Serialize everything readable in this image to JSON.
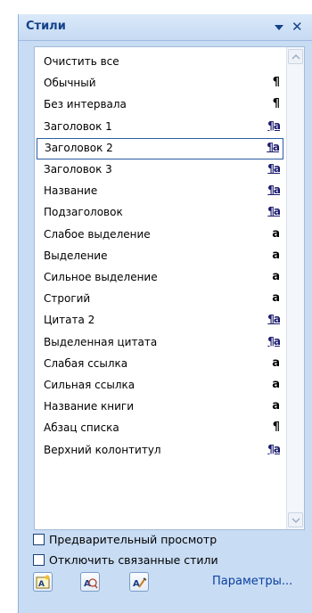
{
  "pane": {
    "title": "Стили",
    "menu_icon": "dropdown-arrow-icon",
    "close_icon": "close-icon"
  },
  "styles": [
    {
      "label": "Очистить все",
      "mark": "",
      "kind": "none"
    },
    {
      "label": "Обычный",
      "mark": "¶",
      "kind": "para"
    },
    {
      "label": "Без интервала",
      "mark": "¶",
      "kind": "para"
    },
    {
      "label": "Заголовок 1",
      "mark": "¶a",
      "kind": "link"
    },
    {
      "label": "Заголовок 2",
      "mark": "¶a",
      "kind": "link",
      "selected": true
    },
    {
      "label": "Заголовок 3",
      "mark": "¶a",
      "kind": "link"
    },
    {
      "label": "Название",
      "mark": "¶a",
      "kind": "link"
    },
    {
      "label": "Подзаголовок",
      "mark": "¶a",
      "kind": "link"
    },
    {
      "label": "Слабое выделение",
      "mark": "a",
      "kind": "char"
    },
    {
      "label": "Выделение",
      "mark": "a",
      "kind": "char"
    },
    {
      "label": "Сильное выделение",
      "mark": "a",
      "kind": "char"
    },
    {
      "label": "Строгий",
      "mark": "a",
      "kind": "char"
    },
    {
      "label": "Цитата 2",
      "mark": "¶a",
      "kind": "link"
    },
    {
      "label": "Выделенная цитата",
      "mark": "¶a",
      "kind": "link"
    },
    {
      "label": "Слабая ссылка",
      "mark": "a",
      "kind": "char"
    },
    {
      "label": "Сильная ссылка",
      "mark": "a",
      "kind": "char"
    },
    {
      "label": "Название книги",
      "mark": "a",
      "kind": "char"
    },
    {
      "label": "Абзац списка",
      "mark": "¶",
      "kind": "para"
    },
    {
      "label": "Верхний колонтитул",
      "mark": "¶a",
      "kind": "link"
    }
  ],
  "options": {
    "preview_label": "Предварительный просмотр",
    "preview_checked": false,
    "disable_linked_label": "Отключить связанные стили",
    "disable_linked_checked": false
  },
  "toolbar": {
    "new_style_icon": "new-style-icon",
    "style_inspector_icon": "style-inspector-icon",
    "manage_styles_icon": "manage-styles-icon",
    "params_label": "Параметры..."
  },
  "colors": {
    "pane_bg": "#c8dcf3",
    "title_text": "#15428b",
    "selection_border": "#2b5da7",
    "link_text": "#0b3fa0"
  }
}
